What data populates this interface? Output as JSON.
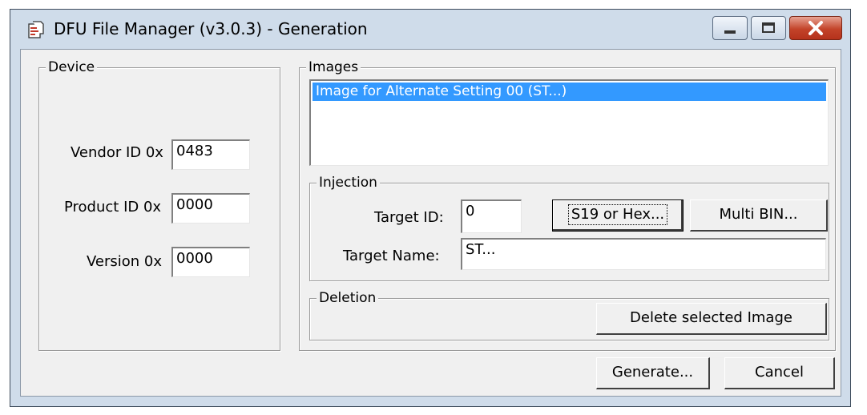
{
  "window": {
    "title": "DFU File Manager (v3.0.3) - Generation"
  },
  "device": {
    "group_label": "Device",
    "vendor_label": "Vendor ID 0x",
    "vendor_value": "0483",
    "product_label": "Product ID 0x",
    "product_value": "0000",
    "version_label": "Version 0x",
    "version_value": "0000"
  },
  "images": {
    "group_label": "Images",
    "items": [
      "Image for Alternate Setting 00  (ST...)"
    ]
  },
  "injection": {
    "group_label": "Injection",
    "target_id_label": "Target ID:",
    "target_id_value": "0",
    "target_name_label": "Target Name:",
    "target_name_value": "ST...",
    "s19_button_label": "S19 or Hex...",
    "multibin_button_label": "Multi BIN..."
  },
  "deletion": {
    "group_label": "Deletion",
    "delete_button_label": "Delete selected Image"
  },
  "footer": {
    "generate_label": "Generate...",
    "cancel_label": "Cancel"
  },
  "icons": {
    "app": "dfu-app-icon",
    "minimize": "minimize-icon",
    "maximize": "maximize-icon",
    "close": "close-icon"
  }
}
